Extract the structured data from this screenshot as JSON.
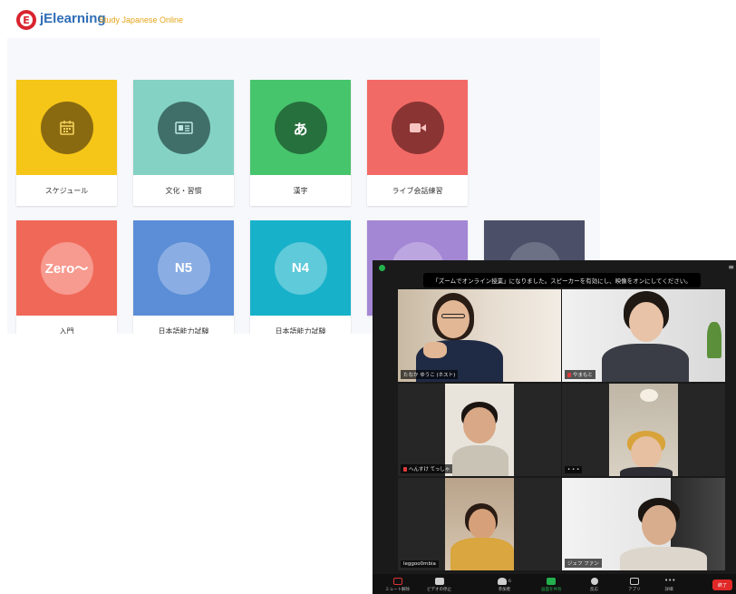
{
  "lms": {
    "logo_letter": "E",
    "app_name": "jElearning",
    "tagline": "Study Japanese Online",
    "cards": [
      {
        "label": "スケジュール",
        "icon": "calendar-icon",
        "icon_text": "",
        "tile_color": "#f5c518",
        "circle_color": "#8a6a10"
      },
      {
        "label": "文化・習慣",
        "icon": "newspaper-icon",
        "icon_text": "",
        "tile_color": "#84d2c4",
        "circle_color": "#3f6f68"
      },
      {
        "label": "漢字",
        "icon": "hiragana-a-icon",
        "icon_text": "あ",
        "tile_color": "#47c56c",
        "circle_color": "#26703d"
      },
      {
        "label": "ライブ会話練習",
        "icon": "video-camera-icon",
        "icon_text": "",
        "tile_color": "#f26a66",
        "circle_color": "#8a3533"
      },
      {
        "label": "入門",
        "icon": "",
        "icon_text": "Zero～",
        "tile_color": "#f06858",
        "circle_color": "#f79a8f"
      },
      {
        "label": "日本語能力試験",
        "icon": "",
        "icon_text": "N5",
        "tile_color": "#5b8ed6",
        "circle_color": "#8aaee3"
      },
      {
        "label": "日本語能力試験",
        "icon": "",
        "icon_text": "N4",
        "tile_color": "#17b1c9",
        "circle_color": "#5fcada"
      },
      {
        "label": "",
        "icon": "",
        "icon_text": "",
        "tile_color": "#a387d4",
        "circle_color": "#bca6e0"
      },
      {
        "label": "",
        "icon": "",
        "icon_text": "",
        "tile_color": "#4b5068",
        "circle_color": "#6d7186"
      }
    ]
  },
  "zoom": {
    "banner": "「ズームでオンライン授業」になりました。スピーカーを有効にし、映像をオンにしてください。",
    "participants": [
      {
        "name": "たなか ゆうこ (ホスト)",
        "active": true
      },
      {
        "name": "やまもと",
        "active": false
      },
      {
        "name": "へんすけ てっしゃ",
        "active": false
      },
      {
        "name": "• • •",
        "active": false
      },
      {
        "name": "leggoo0mbia",
        "active": false
      },
      {
        "name": "ジェフ ファン",
        "active": false
      }
    ],
    "toolbar": {
      "mute": "ミュート解除",
      "video": "ビデオの停止",
      "participants": "参加者",
      "participants_count": "6",
      "share": "画面を共有",
      "reactions": "反応",
      "apps": "アプリ",
      "more": "詳細",
      "end": "終了"
    },
    "colors": {
      "active_speaker": "#d9e14b",
      "end_button": "#e02828",
      "share_green": "#23b14d"
    }
  }
}
